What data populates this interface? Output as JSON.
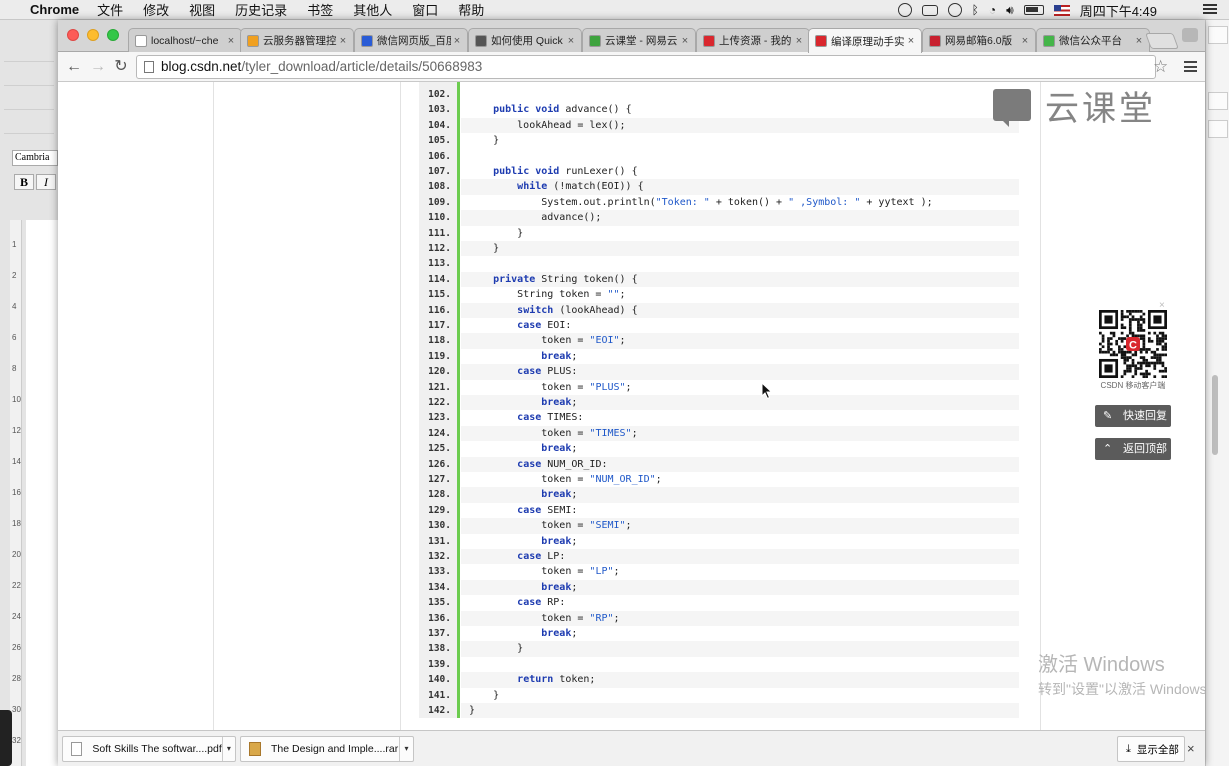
{
  "menubar": {
    "app": "Chrome",
    "menus": [
      "文件",
      "修改",
      "视图",
      "历史记录",
      "书签",
      "其他人",
      "窗口",
      "帮助"
    ],
    "clock": "周四下午4:49"
  },
  "tabs": [
    {
      "title": "localhost/~che",
      "color": "#ffffff",
      "active": false
    },
    {
      "title": "云服务器管理控",
      "color": "#f0a020",
      "active": false
    },
    {
      "title": "微信网页版_百度",
      "color": "#2a5cd6",
      "active": false
    },
    {
      "title": "如何使用 Quick",
      "color": "#555555",
      "active": false
    },
    {
      "title": "云课堂 - 网易云",
      "color": "#3ea33e",
      "active": false
    },
    {
      "title": "上传资源 - 我的",
      "color": "#d9272e",
      "active": false
    },
    {
      "title": "编译原理动手实",
      "color": "#d9272e",
      "active": true
    },
    {
      "title": "网易邮箱6.0版",
      "color": "#c8202f",
      "active": false
    },
    {
      "title": "微信公众平台",
      "color": "#44b549",
      "active": false
    }
  ],
  "address": {
    "host": "blog.csdn.net",
    "path": "/tyler_download/article/details/50668983"
  },
  "code_lines": [
    {
      "n": "102.",
      "parts": [
        {
          "t": ""
        }
      ]
    },
    {
      "n": "103.",
      "parts": [
        {
          "t": "    "
        },
        {
          "t": "public",
          "c": "kw"
        },
        {
          "t": " "
        },
        {
          "t": "void",
          "c": "kw"
        },
        {
          "t": " advance() {"
        }
      ]
    },
    {
      "n": "104.",
      "parts": [
        {
          "t": "        lookAhead = lex();"
        }
      ]
    },
    {
      "n": "105.",
      "parts": [
        {
          "t": "    }"
        }
      ]
    },
    {
      "n": "106.",
      "parts": [
        {
          "t": ""
        }
      ]
    },
    {
      "n": "107.",
      "parts": [
        {
          "t": "    "
        },
        {
          "t": "public",
          "c": "kw"
        },
        {
          "t": " "
        },
        {
          "t": "void",
          "c": "kw"
        },
        {
          "t": " runLexer() {"
        }
      ]
    },
    {
      "n": "108.",
      "parts": [
        {
          "t": "        "
        },
        {
          "t": "while",
          "c": "kw"
        },
        {
          "t": " (!match(EOI)) {"
        }
      ]
    },
    {
      "n": "109.",
      "parts": [
        {
          "t": "            System.out.println("
        },
        {
          "t": "\"Token: \"",
          "c": "str"
        },
        {
          "t": " + token() + "
        },
        {
          "t": "\" ,Symbol: \"",
          "c": "str"
        },
        {
          "t": " + yytext );"
        }
      ]
    },
    {
      "n": "110.",
      "parts": [
        {
          "t": "            advance();"
        }
      ]
    },
    {
      "n": "111.",
      "parts": [
        {
          "t": "        }"
        }
      ]
    },
    {
      "n": "112.",
      "parts": [
        {
          "t": "    }"
        }
      ]
    },
    {
      "n": "113.",
      "parts": [
        {
          "t": ""
        }
      ]
    },
    {
      "n": "114.",
      "parts": [
        {
          "t": "    "
        },
        {
          "t": "private",
          "c": "kw"
        },
        {
          "t": " String token() {"
        }
      ]
    },
    {
      "n": "115.",
      "parts": [
        {
          "t": "        String token = "
        },
        {
          "t": "\"\"",
          "c": "str"
        },
        {
          "t": ";"
        }
      ]
    },
    {
      "n": "116.",
      "parts": [
        {
          "t": "        "
        },
        {
          "t": "switch",
          "c": "kw"
        },
        {
          "t": " (lookAhead) {"
        }
      ]
    },
    {
      "n": "117.",
      "parts": [
        {
          "t": "        "
        },
        {
          "t": "case",
          "c": "kw"
        },
        {
          "t": " EOI:"
        }
      ]
    },
    {
      "n": "118.",
      "parts": [
        {
          "t": "            token = "
        },
        {
          "t": "\"EOI\"",
          "c": "str"
        },
        {
          "t": ";"
        }
      ]
    },
    {
      "n": "119.",
      "parts": [
        {
          "t": "            "
        },
        {
          "t": "break",
          "c": "kw"
        },
        {
          "t": ";"
        }
      ]
    },
    {
      "n": "120.",
      "parts": [
        {
          "t": "        "
        },
        {
          "t": "case",
          "c": "kw"
        },
        {
          "t": " PLUS:"
        }
      ]
    },
    {
      "n": "121.",
      "parts": [
        {
          "t": "            token = "
        },
        {
          "t": "\"PLUS\"",
          "c": "str"
        },
        {
          "t": ";"
        }
      ]
    },
    {
      "n": "122.",
      "parts": [
        {
          "t": "            "
        },
        {
          "t": "break",
          "c": "kw"
        },
        {
          "t": ";"
        }
      ]
    },
    {
      "n": "123.",
      "parts": [
        {
          "t": "        "
        },
        {
          "t": "case",
          "c": "kw"
        },
        {
          "t": " TIMES:"
        }
      ]
    },
    {
      "n": "124.",
      "parts": [
        {
          "t": "            token = "
        },
        {
          "t": "\"TIMES\"",
          "c": "str"
        },
        {
          "t": ";"
        }
      ]
    },
    {
      "n": "125.",
      "parts": [
        {
          "t": "            "
        },
        {
          "t": "break",
          "c": "kw"
        },
        {
          "t": ";"
        }
      ]
    },
    {
      "n": "126.",
      "parts": [
        {
          "t": "        "
        },
        {
          "t": "case",
          "c": "kw"
        },
        {
          "t": " NUM_OR_ID:"
        }
      ]
    },
    {
      "n": "127.",
      "parts": [
        {
          "t": "            token = "
        },
        {
          "t": "\"NUM_OR_ID\"",
          "c": "str"
        },
        {
          "t": ";"
        }
      ]
    },
    {
      "n": "128.",
      "parts": [
        {
          "t": "            "
        },
        {
          "t": "break",
          "c": "kw"
        },
        {
          "t": ";"
        }
      ]
    },
    {
      "n": "129.",
      "parts": [
        {
          "t": "        "
        },
        {
          "t": "case",
          "c": "kw"
        },
        {
          "t": " SEMI:"
        }
      ]
    },
    {
      "n": "130.",
      "parts": [
        {
          "t": "            token = "
        },
        {
          "t": "\"SEMI\"",
          "c": "str"
        },
        {
          "t": ";"
        }
      ]
    },
    {
      "n": "131.",
      "parts": [
        {
          "t": "            "
        },
        {
          "t": "break",
          "c": "kw"
        },
        {
          "t": ";"
        }
      ]
    },
    {
      "n": "132.",
      "parts": [
        {
          "t": "        "
        },
        {
          "t": "case",
          "c": "kw"
        },
        {
          "t": " LP:"
        }
      ]
    },
    {
      "n": "133.",
      "parts": [
        {
          "t": "            token = "
        },
        {
          "t": "\"LP\"",
          "c": "str"
        },
        {
          "t": ";"
        }
      ]
    },
    {
      "n": "134.",
      "parts": [
        {
          "t": "            "
        },
        {
          "t": "break",
          "c": "kw"
        },
        {
          "t": ";"
        }
      ]
    },
    {
      "n": "135.",
      "parts": [
        {
          "t": "        "
        },
        {
          "t": "case",
          "c": "kw"
        },
        {
          "t": " RP:"
        }
      ]
    },
    {
      "n": "136.",
      "parts": [
        {
          "t": "            token = "
        },
        {
          "t": "\"RP\"",
          "c": "str"
        },
        {
          "t": ";"
        }
      ]
    },
    {
      "n": "137.",
      "parts": [
        {
          "t": "            "
        },
        {
          "t": "break",
          "c": "kw"
        },
        {
          "t": ";"
        }
      ]
    },
    {
      "n": "138.",
      "parts": [
        {
          "t": "        }"
        }
      ]
    },
    {
      "n": "139.",
      "parts": [
        {
          "t": ""
        }
      ]
    },
    {
      "n": "140.",
      "parts": [
        {
          "t": "        "
        },
        {
          "t": "return",
          "c": "kw"
        },
        {
          "t": " token;"
        }
      ]
    },
    {
      "n": "141.",
      "parts": [
        {
          "t": "    }"
        }
      ]
    },
    {
      "n": "142.",
      "parts": [
        {
          "t": "}"
        }
      ]
    }
  ],
  "logo": {
    "text": "云课堂"
  },
  "qr": {
    "label": "CSDN 移动客户端",
    "close": "×"
  },
  "side_buttons": {
    "quick_reply": "快速回复",
    "back_to_top": "返回顶部"
  },
  "activate": {
    "line1": "激活 Windows",
    "line2": "转到\"设置\"以激活 Windows。"
  },
  "left_app": {
    "font_name": "Cambria",
    "bold": "B",
    "italic": "I",
    "ruler_marks": [
      "1",
      "2",
      "4",
      "6",
      "8",
      "10",
      "12",
      "14",
      "16",
      "18",
      "20",
      "22",
      "24",
      "26",
      "28",
      "30",
      "32"
    ]
  },
  "downloads": [
    {
      "name": "Soft Skills The softwar....pdf",
      "type": "pdf"
    },
    {
      "name": "The Design and Imple....rar",
      "type": "rar"
    }
  ],
  "shelf": {
    "show_all": "显示全部",
    "close": "×"
  },
  "accent_colors": {
    "code_bar": "#6ccc4f",
    "keyword": "#1d3bb0",
    "string": "#1f58c9"
  }
}
